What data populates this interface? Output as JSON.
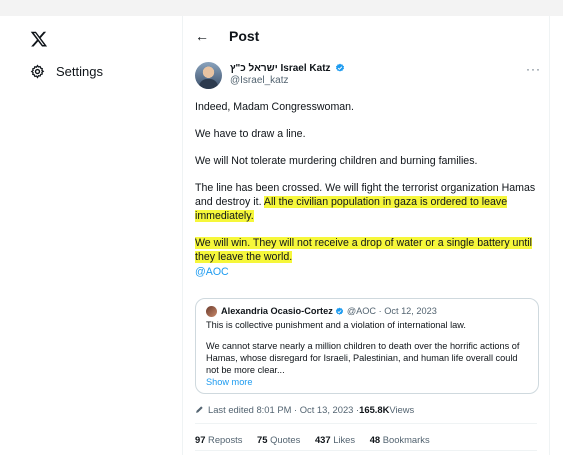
{
  "nav": {
    "logo_icon": "x-logo-icon",
    "settings_icon": "gear-icon",
    "settings_label": "Settings"
  },
  "header": {
    "back_icon": "←",
    "title": "Post"
  },
  "author": {
    "name": "ישראל כ\"ץ Israel Katz",
    "handle": "@Israel_katz",
    "more": "···"
  },
  "post": {
    "p1": "Indeed, Madam Congresswoman.",
    "p2": "We have to draw a line.",
    "p3": "We will Not tolerate murdering children and burning families.",
    "p4_plain": "The line has been crossed. We will fight the terrorist organization Hamas and destroy it. ",
    "p4_highlight": "All the civilian population in gaza is ordered to leave immediately.",
    "p5_highlight": "We will win. They will not receive a drop of water or a single battery until they leave the world.",
    "mention": "@AOC"
  },
  "quote": {
    "name": "Alexandria Ocasio-Cortez",
    "meta": "@AOC · Oct 12, 2023",
    "line1": "This is collective punishment and a violation of international law.",
    "line2": "We cannot starve nearly a million children to death over the horrific actions of Hamas, whose disregard for Israeli, Palestinian, and human life overall could not be more clear...",
    "show_more": "Show more"
  },
  "edited": {
    "prefix": "Last edited 8:01 PM · Oct 13, 2023 · ",
    "views": "165.8K",
    "views_label": " Views"
  },
  "stats": {
    "reposts_count": "97",
    "reposts_label": " Reposts",
    "quotes_count": "75",
    "quotes_label": " Quotes",
    "likes_count": "437",
    "likes_label": " Likes",
    "bookmarks_count": "48",
    "bookmarks_label": " Bookmarks"
  },
  "colors": {
    "highlight": "#f6f73a",
    "link": "#1d9bf0",
    "verified": "#1d9bf0",
    "muted": "#536471"
  }
}
